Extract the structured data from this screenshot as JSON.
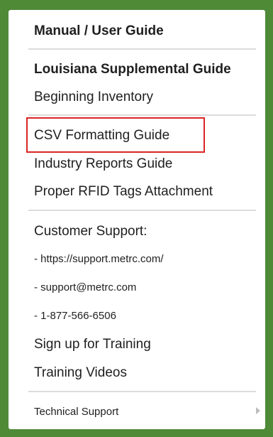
{
  "menu": {
    "header": "Manual / User Guide",
    "items": [
      {
        "label": "Louisiana Supplemental Guide"
      },
      {
        "label": "Beginning Inventory"
      },
      {
        "label": "CSV Formatting Guide"
      },
      {
        "label": "Industry Reports Guide"
      },
      {
        "label": "Proper RFID Tags Attachment"
      },
      {
        "label": "Customer Support:"
      },
      {
        "label": "- https://support.metrc.com/"
      },
      {
        "label": "- support@metrc.com"
      },
      {
        "label": "- 1-877-566-6506"
      },
      {
        "label": "Sign up for Training"
      },
      {
        "label": "Training Videos"
      },
      {
        "label": "Technical Support"
      }
    ]
  },
  "colors": {
    "border_green": "#4f8a37",
    "highlight_red": "#d92525"
  },
  "icons": {
    "submenu_arrow": "chevron-right-icon"
  }
}
